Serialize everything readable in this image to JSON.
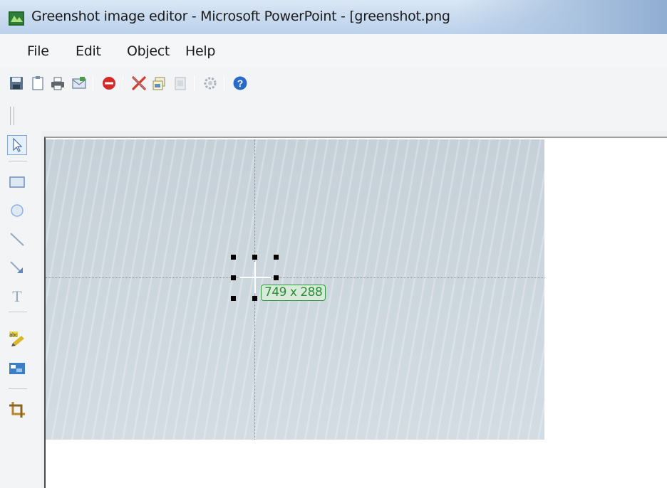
{
  "window": {
    "title": "Greenshot image editor - Microsoft PowerPoint - [greenshot.png",
    "icon": "greenshot-app-icon"
  },
  "menu": {
    "items": [
      {
        "label": "File"
      },
      {
        "label": "Edit"
      },
      {
        "label": "Object"
      },
      {
        "label": "Help"
      }
    ]
  },
  "toolbar": {
    "buttons": [
      {
        "icon": "save-icon"
      },
      {
        "icon": "clipboard-icon"
      },
      {
        "icon": "print-icon"
      },
      {
        "icon": "email-icon"
      },
      {
        "icon": "close-icon"
      },
      {
        "icon": "cut-icon"
      },
      {
        "icon": "copy-icon"
      },
      {
        "icon": "paste-icon"
      },
      {
        "icon": "settings-icon"
      },
      {
        "icon": "help-icon"
      }
    ]
  },
  "tools": [
    {
      "icon": "cursor-icon",
      "selected": true
    },
    {
      "icon": "rectangle-icon"
    },
    {
      "icon": "ellipse-icon"
    },
    {
      "icon": "line-icon"
    },
    {
      "icon": "arrow-icon"
    },
    {
      "icon": "text-icon"
    },
    {
      "icon": "highlight-icon"
    },
    {
      "icon": "obfuscate-icon"
    },
    {
      "icon": "crop-icon"
    }
  ],
  "canvas": {
    "size_label": "749 x 288"
  },
  "colors": {
    "guide": "#2fb5b0",
    "size_label_border": "#2e9a3a",
    "help_blue": "#2a6bc7",
    "stop_red": "#d42a2a"
  }
}
